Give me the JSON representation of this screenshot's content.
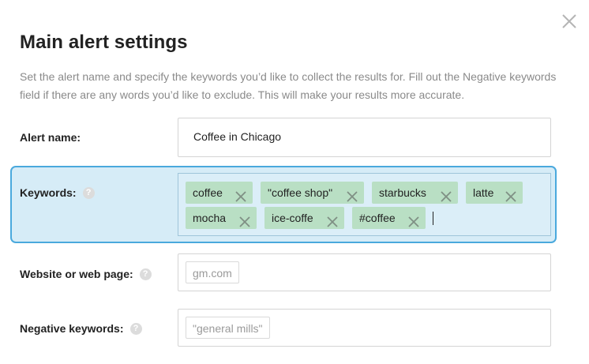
{
  "dialog": {
    "title": "Main alert settings",
    "description": "Set the alert name and specify the keywords you’d like to collect the results for. Fill out the Negative keywords field if there are any words you’d like to exclude. This will make your results more accurate.",
    "close_icon": "close-icon"
  },
  "alert_name": {
    "label": "Alert name:",
    "value": "Coffee in Chicago"
  },
  "keywords": {
    "label": "Keywords:",
    "help": "?",
    "tags": [
      "coffee",
      "\"coffee shop\"",
      "starbucks",
      "latte",
      "mocha",
      "ice-coffe",
      "#coffee"
    ]
  },
  "website": {
    "label": "Website or web page:",
    "help": "?",
    "placeholder": "gm.com"
  },
  "negative_keywords": {
    "label": "Negative keywords:",
    "help": "?",
    "placeholder": "\"general mills\""
  },
  "colors": {
    "tag_bg": "#b9dfc4",
    "focus_border": "#4aa9dd",
    "focus_bg": "#d6ecf7"
  }
}
